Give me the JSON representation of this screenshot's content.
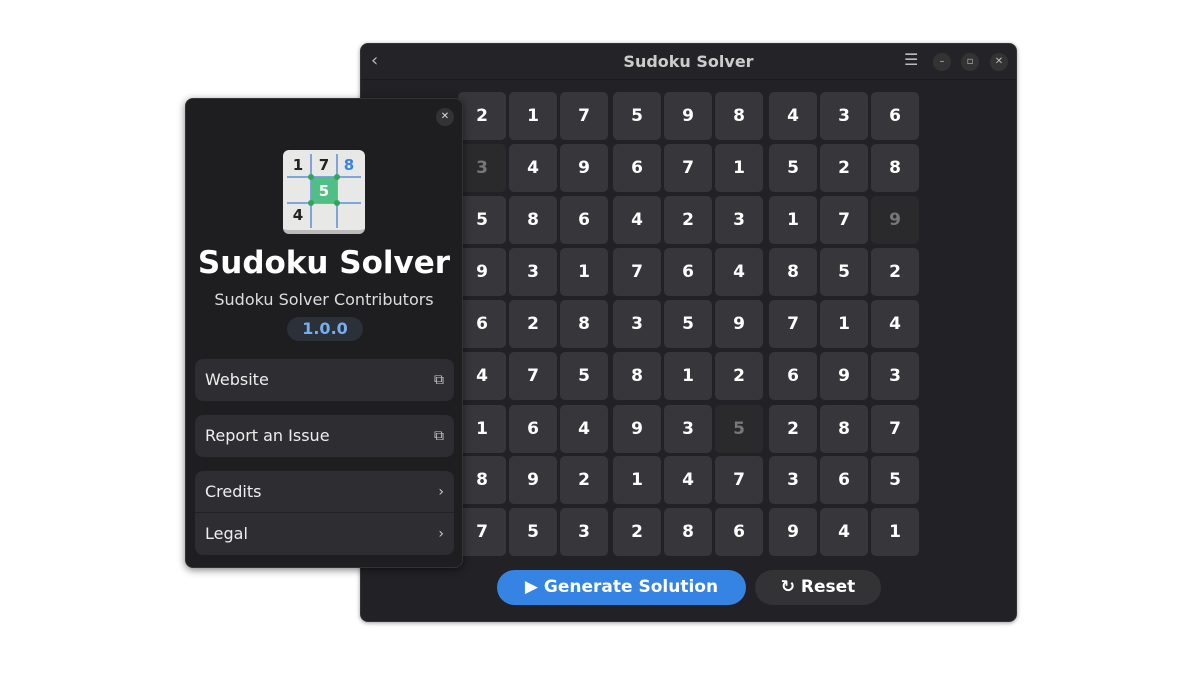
{
  "window": {
    "title": "Sudoku Solver",
    "back_icon": "chevron-left-icon",
    "menu_icon": "hamburger-menu-icon"
  },
  "grid": [
    [
      2,
      1,
      7,
      5,
      9,
      8,
      4,
      3,
      6
    ],
    [
      3,
      4,
      9,
      6,
      7,
      1,
      5,
      2,
      8
    ],
    [
      5,
      8,
      6,
      4,
      2,
      3,
      1,
      7,
      9
    ],
    [
      9,
      3,
      1,
      7,
      6,
      4,
      8,
      5,
      2
    ],
    [
      6,
      2,
      8,
      3,
      5,
      9,
      7,
      1,
      4
    ],
    [
      4,
      7,
      5,
      8,
      1,
      2,
      6,
      9,
      3
    ],
    [
      1,
      6,
      4,
      9,
      3,
      5,
      2,
      8,
      7
    ],
    [
      8,
      9,
      2,
      1,
      4,
      7,
      3,
      6,
      5
    ],
    [
      7,
      5,
      3,
      2,
      8,
      6,
      9,
      4,
      1
    ]
  ],
  "dimmed_cells": [
    [
      1,
      0
    ],
    [
      2,
      8
    ],
    [
      6,
      5
    ]
  ],
  "actions": {
    "generate": "Generate Solution",
    "reset": "Reset"
  },
  "about": {
    "app_name": "Sudoku Solver",
    "developer": "Sudoku Solver Contributors",
    "version": "1.0.0",
    "icon_digits": [
      "1",
      "7",
      "8",
      "5",
      "4"
    ],
    "links": [
      {
        "label": "Website",
        "icon": "external-link-icon"
      },
      {
        "label": "Report an Issue",
        "icon": "external-link-icon"
      }
    ],
    "nav": [
      {
        "label": "Credits",
        "icon": "chevron-right-icon"
      },
      {
        "label": "Legal",
        "icon": "chevron-right-icon"
      }
    ]
  },
  "colors": {
    "accent": "#3584e4",
    "version": "#78aeed"
  }
}
